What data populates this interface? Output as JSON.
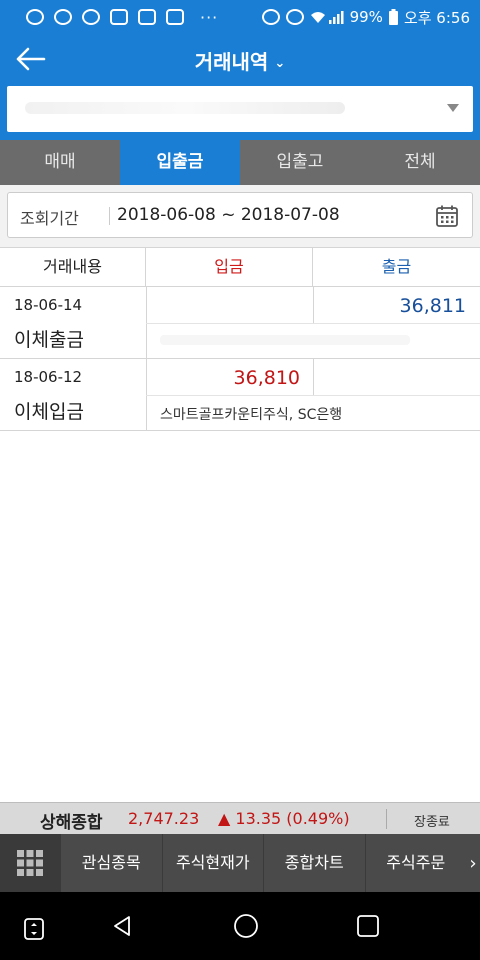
{
  "status_bar": {
    "battery": "99%",
    "time": "오후 6:56",
    "dots": "···"
  },
  "header": {
    "title": "거래내역"
  },
  "account": {},
  "tabs": [
    "매매",
    "입출금",
    "입출고",
    "전체"
  ],
  "period": {
    "label": "조회기간",
    "range": "2018-06-08 ~ 2018-07-08"
  },
  "table": {
    "headers": [
      "거래내용",
      "입금",
      "출금"
    ],
    "rows": [
      {
        "date": "18-06-14",
        "type": "이체출금",
        "deposit": "",
        "withdrawal": "36,811",
        "memo": ""
      },
      {
        "date": "18-06-12",
        "type": "이체입금",
        "deposit": "36,810",
        "withdrawal": "",
        "memo": "스마트골프카운티주식, SC은행"
      }
    ]
  },
  "ticker": {
    "name": "상해종합",
    "value": "2,747.23",
    "change": "▲ 13.35 (0.49%)",
    "status": "장종료"
  },
  "bottom_menu": [
    "관심종목",
    "주식현재가",
    "종합차트",
    "주식주문"
  ],
  "colors": {
    "primary": "#1a7fd4",
    "deposit": "#c21515",
    "withdrawal": "#174f9a",
    "tab_inactive": "#6b6b6b"
  }
}
